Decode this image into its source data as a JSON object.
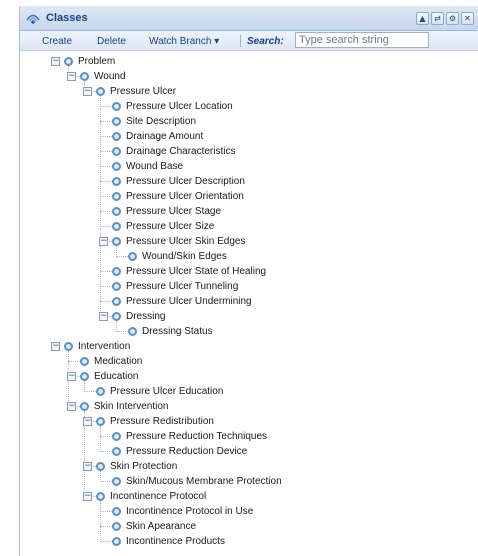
{
  "panel": {
    "title": "Classes",
    "tools": [
      "▲",
      "⇄",
      "⚙",
      "✕"
    ]
  },
  "toolbar": {
    "create_label": "Create",
    "delete_label": "Delete",
    "watch_branch_label": "Watch Branch ▾",
    "search_label": "Search:",
    "search_placeholder": "Type search string"
  },
  "tree": [
    {
      "label": "Problem",
      "depth": 0,
      "expanded": true
    },
    {
      "label": "Wound",
      "depth": 1,
      "expanded": true
    },
    {
      "label": "Pressure Ulcer",
      "depth": 2,
      "expanded": true
    },
    {
      "label": "Pressure Ulcer Location",
      "depth": 3
    },
    {
      "label": "Site Description",
      "depth": 3
    },
    {
      "label": "Drainage Amount",
      "depth": 3
    },
    {
      "label": "Drainage Characteristics",
      "depth": 3
    },
    {
      "label": "Wound Base",
      "depth": 3
    },
    {
      "label": "Pressure Ulcer Description",
      "depth": 3
    },
    {
      "label": "Pressure Ulcer Orientation",
      "depth": 3
    },
    {
      "label": "Pressure Ulcer Stage",
      "depth": 3
    },
    {
      "label": "Pressure Ulcer Size",
      "depth": 3
    },
    {
      "label": "Pressure Ulcer Skin Edges",
      "depth": 3,
      "expanded": true
    },
    {
      "label": "Wound/Skin Edges",
      "depth": 4
    },
    {
      "label": "Pressure Ulcer State of Healing",
      "depth": 3
    },
    {
      "label": "Pressure Ulcer Tunneling",
      "depth": 3
    },
    {
      "label": "Pressure Ulcer Undermining",
      "depth": 3
    },
    {
      "label": "Dressing",
      "depth": 3,
      "expanded": true
    },
    {
      "label": "Dressing Status",
      "depth": 4
    },
    {
      "label": "Intervention",
      "depth": 0,
      "expanded": true
    },
    {
      "label": "Medication",
      "depth": 1
    },
    {
      "label": "Education",
      "depth": 1,
      "expanded": true
    },
    {
      "label": "Pressure Ulcer Education",
      "depth": 2
    },
    {
      "label": "Skin Intervention",
      "depth": 1,
      "expanded": true
    },
    {
      "label": "Pressure Redistribution",
      "depth": 2,
      "expanded": true
    },
    {
      "label": "Pressure Reduction Techniques",
      "depth": 3
    },
    {
      "label": "Pressure Reduction Device",
      "depth": 3
    },
    {
      "label": "Skin Protection",
      "depth": 2,
      "expanded": true
    },
    {
      "label": "Skin/Mucous Membrane Protection",
      "depth": 3
    },
    {
      "label": "Incontinence Protocol",
      "depth": 2,
      "expanded": true
    },
    {
      "label": "Incontinence Protocol in Use",
      "depth": 3
    },
    {
      "label": "Skin Apearance",
      "depth": 3
    },
    {
      "label": "Incontinence Products",
      "depth": 3
    }
  ],
  "colors": {
    "header_bg": "#c5d6eb",
    "title_text": "#15428b",
    "node_circle": "#5b8fc9"
  },
  "icons": {
    "panel_icon": "classes-icon",
    "expander": "minus-box-icon",
    "node": "circle-node-icon"
  }
}
